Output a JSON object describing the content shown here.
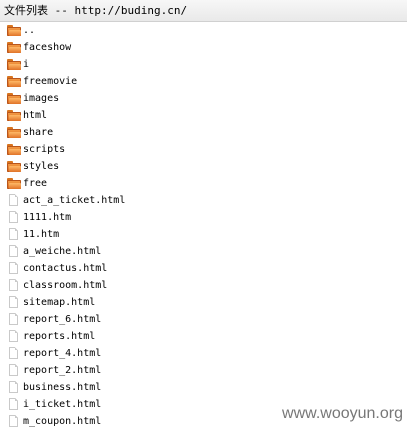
{
  "header": {
    "title": "文件列表 -- http://buding.cn/"
  },
  "listing": {
    "entries": [
      {
        "name": "..",
        "type": "folder"
      },
      {
        "name": "faceshow",
        "type": "folder"
      },
      {
        "name": "i",
        "type": "folder"
      },
      {
        "name": "freemovie",
        "type": "folder"
      },
      {
        "name": "images",
        "type": "folder"
      },
      {
        "name": "html",
        "type": "folder"
      },
      {
        "name": "share",
        "type": "folder"
      },
      {
        "name": "scripts",
        "type": "folder"
      },
      {
        "name": "styles",
        "type": "folder"
      },
      {
        "name": "free",
        "type": "folder"
      },
      {
        "name": "act_a_ticket.html",
        "type": "file"
      },
      {
        "name": "1111.htm",
        "type": "file"
      },
      {
        "name": "11.htm",
        "type": "file"
      },
      {
        "name": "a_weiche.html",
        "type": "file"
      },
      {
        "name": "contactus.html",
        "type": "file"
      },
      {
        "name": "classroom.html",
        "type": "file"
      },
      {
        "name": "sitemap.html",
        "type": "file"
      },
      {
        "name": "report_6.html",
        "type": "file"
      },
      {
        "name": "reports.html",
        "type": "file"
      },
      {
        "name": "report_4.html",
        "type": "file"
      },
      {
        "name": "report_2.html",
        "type": "file"
      },
      {
        "name": "business.html",
        "type": "file"
      },
      {
        "name": "i_ticket.html",
        "type": "file"
      },
      {
        "name": "m_coupon.html",
        "type": "file"
      }
    ]
  },
  "watermark": {
    "text": "www.wooyun.org"
  },
  "icons": {
    "folder": "folder-icon",
    "file": "file-icon"
  },
  "colors": {
    "folder": "#e07328",
    "title_bar": "#eeeeee",
    "watermark": "#777777"
  }
}
